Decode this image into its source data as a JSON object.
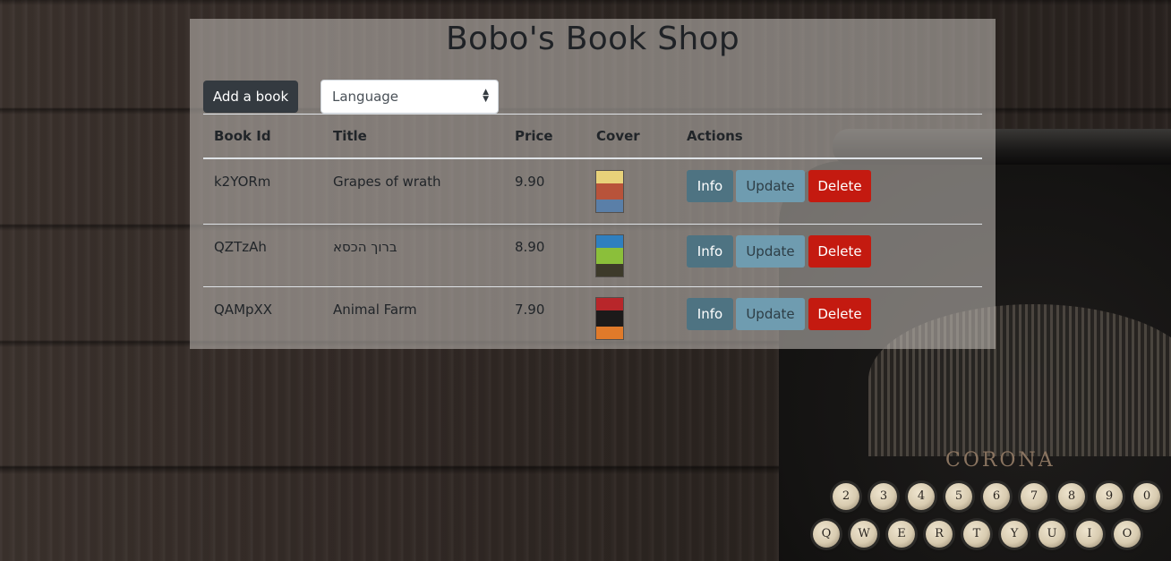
{
  "page": {
    "title": "Bobo's Book Shop"
  },
  "toolbar": {
    "add_label": "Add a book",
    "language": {
      "selected": "Language"
    }
  },
  "table": {
    "headers": [
      "Book Id",
      "Title",
      "Price",
      "Cover",
      "Actions"
    ],
    "rows": [
      {
        "id": "k2YORm",
        "title": "Grapes of wrath",
        "price": "9.90",
        "cover_colors": [
          "#e8d27a",
          "#b8533a",
          "#5a7fa8"
        ]
      },
      {
        "id": "QZTzAh",
        "title": "ברוך הכסא",
        "price": "8.90",
        "cover_colors": [
          "#2f7fbf",
          "#8bbf3a",
          "#3d3a2a"
        ]
      },
      {
        "id": "QAMpXX",
        "title": "Animal Farm",
        "price": "7.90",
        "cover_colors": [
          "#b8262a",
          "#1c1a1a",
          "#e07a2a"
        ]
      }
    ],
    "actions": {
      "info": "Info",
      "update": "Update",
      "delete": "Delete"
    }
  },
  "background": {
    "brand": "CORONA",
    "keys_top": [
      "2",
      "3",
      "4",
      "5",
      "6",
      "7",
      "8",
      "9",
      "0"
    ],
    "keys_bottom": [
      "Q",
      "W",
      "E",
      "R",
      "T",
      "Y",
      "U",
      "I",
      "O"
    ]
  },
  "colors": {
    "add_button": "#343a40",
    "info_button": "#4e7382",
    "update_button": "#6f9cb0",
    "delete_button": "#c41a10"
  }
}
